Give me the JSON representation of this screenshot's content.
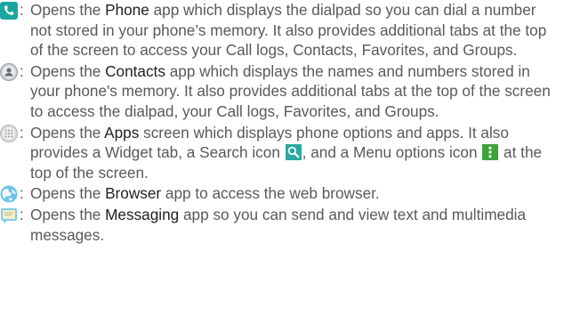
{
  "entries": [
    {
      "icon": "phone-icon",
      "colon": ":",
      "before": " Opens the ",
      "app": "Phone",
      "after": " app which displays the dialpad so you can dial a number not stored in your phone’s memory. It also provides additional tabs at the top of the screen to access your Call logs, Contacts, Favorites, and Groups."
    },
    {
      "icon": "contacts-icon",
      "colon": ":",
      "before": " Opens the ",
      "app": "Contacts",
      "after": " app which displays the names and numbers stored in your phone's memory. It also provides additional tabs at the top of the screen to access the dialpad, your Call logs, Favorites, and Groups."
    },
    {
      "icon": "apps-icon",
      "colon": ":",
      "before": " Opens the ",
      "app": "Apps",
      "after_1": " screen which displays phone options and apps. It also provides a Widget tab, a Search icon ",
      "inline_icon_1": "search-icon",
      "after_2": ", and a Menu options icon ",
      "inline_icon_2": "menu-options-icon",
      "after_3": " at the top of the screen."
    },
    {
      "icon": "browser-icon",
      "colon": ":",
      "before": " Opens the ",
      "app": "Browser",
      "after": " app to access the web browser."
    },
    {
      "icon": "messaging-icon",
      "colon": ":",
      "before": " Opens the ",
      "app": "Messaging",
      "after": " app so you can send and view text and multimedia messages."
    }
  ],
  "colors": {
    "body_text": "#595959",
    "app_name_text": "#1f1f1f",
    "phone_icon": "#1aa6a0",
    "search_icon": "#2ba8a1",
    "menu_icon": "#3aa33a"
  }
}
